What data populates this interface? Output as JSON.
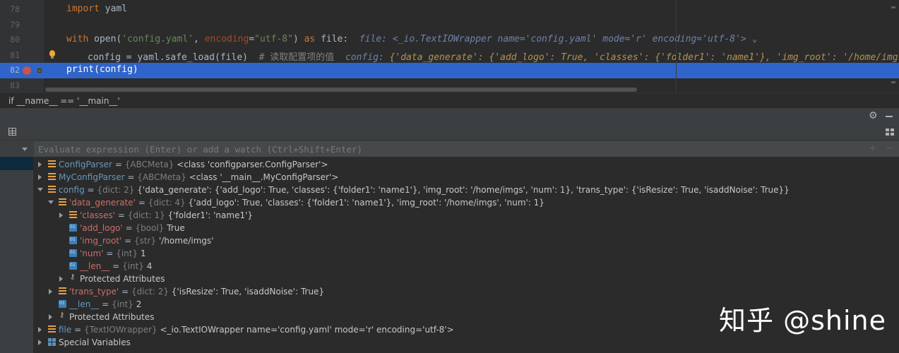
{
  "editor": {
    "lines": [
      {
        "num": "78"
      },
      {
        "num": "79"
      },
      {
        "num": "80"
      },
      {
        "num": "81"
      },
      {
        "num": "82"
      },
      {
        "num": "83"
      }
    ],
    "code": {
      "l78_kw": "import",
      "l78_rest": " yaml",
      "l80_kw": "with",
      "l80_a": " open(",
      "l80_str1": "'config.yaml'",
      "l80_b": ", ",
      "l80_param": "encoding",
      "l80_c": "=",
      "l80_str2": "\"utf-8\"",
      "l80_d": ") ",
      "l80_kw2": "as",
      "l80_e": " file:",
      "l80_inline": "file: <_io.TextIOWrapper name='config.yaml' mode='r' encoding='utf-8'>",
      "l81_code": "config = yaml.safe_load(file)",
      "l81_comment": "# 读取配置项的值",
      "l81_inline_label": "config:",
      "l81_inline_val": "{'data_generate': {'add_logo': True, 'classes': {'folder1': 'name1'}, 'img_root': '/home/imgs', 'nu",
      "l82_code": "print(config)"
    }
  },
  "breadcrumb": "if __name__ == '__main__'",
  "evaluate": {
    "placeholder": "Evaluate expression (Enter) or add a watch (Ctrl+Shift+Enter)"
  },
  "variables": [
    {
      "name": "ConfigParser",
      "eq": " = ",
      "type": "{ABCMeta}",
      "value": "<class 'configparser.ConfigParser'>"
    },
    {
      "name": "MyConfigParser",
      "eq": " = ",
      "type": "{ABCMeta}",
      "value": "<class '__main__.MyConfigParser'>"
    },
    {
      "name": "config",
      "eq": " = ",
      "type": "{dict: 2}",
      "value": "{'data_generate': {'add_logo': True, 'classes': {'folder1': 'name1'}, 'img_root': '/home/imgs', 'num': 1}, 'trans_type': {'isResize': True, 'isaddNoise': True}}"
    },
    {
      "name": "'data_generate'",
      "eq": " = ",
      "type": "{dict: 4}",
      "value": "{'add_logo': True, 'classes': {'folder1': 'name1'}, 'img_root': '/home/imgs', 'num': 1}"
    },
    {
      "name": "'classes'",
      "eq": " = ",
      "type": "{dict: 1}",
      "value": "{'folder1': 'name1'}"
    },
    {
      "name": "'add_logo'",
      "eq": " = ",
      "type": "{bool}",
      "value": "True"
    },
    {
      "name": "'img_root'",
      "eq": " = ",
      "type": "{str}",
      "value": "'/home/imgs'"
    },
    {
      "name": "'num'",
      "eq": " = ",
      "type": "{int}",
      "value": "1"
    },
    {
      "name": "__len__",
      "eq": " = ",
      "type": "{int}",
      "value": "4"
    },
    {
      "name": "Protected Attributes"
    },
    {
      "name": "'trans_type'",
      "eq": " = ",
      "type": "{dict: 2}",
      "value": "{'isResize': True, 'isaddNoise': True}"
    },
    {
      "name": "__len__",
      "eq": " = ",
      "type": "{int}",
      "value": "2"
    },
    {
      "name": "Protected Attributes"
    },
    {
      "name": "file",
      "eq": " = ",
      "type": "{TextIOWrapper}",
      "value": "<_io.TextIOWrapper name='config.yaml' mode='r' encoding='utf-8'>"
    },
    {
      "name": "Special Variables"
    }
  ],
  "watermark": "知乎 @shine",
  "colors": {
    "selection": "#2f65ca",
    "breakpoint": "#c75450",
    "keyword": "#cc7832",
    "string": "#6a8759"
  }
}
